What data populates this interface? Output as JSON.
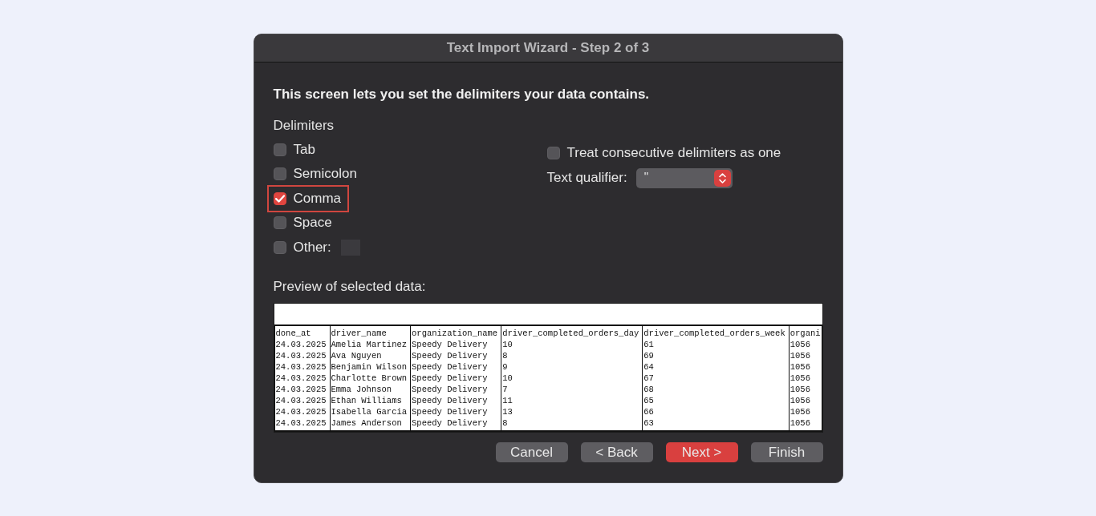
{
  "window": {
    "title": "Text Import Wizard - Step 2 of 3"
  },
  "instruction": "This screen lets you set the delimiters your data contains.",
  "delimiters": {
    "heading": "Delimiters",
    "options": [
      {
        "label": "Tab",
        "kind": "plain",
        "checked": false,
        "highlighted": false
      },
      {
        "label": "Semicolon",
        "kind": "plain",
        "checked": false,
        "highlighted": false
      },
      {
        "label": "Comma",
        "kind": "plain",
        "checked": true,
        "highlighted": true
      },
      {
        "label": "Space",
        "kind": "plain",
        "checked": false,
        "highlighted": false
      },
      {
        "label": "Other:",
        "kind": "field",
        "checked": false,
        "highlighted": false
      }
    ]
  },
  "consecutive": {
    "label": "Treat consecutive delimiters as one",
    "checked": false
  },
  "text_qualifier": {
    "label": "Text qualifier:",
    "value": "\""
  },
  "preview": {
    "label": "Preview of selected data:",
    "columns": [
      "done_at",
      "driver_name",
      "organization_name",
      "driver_completed_orders_day",
      "driver_completed_orders_week",
      "organi"
    ],
    "rows": [
      [
        "24.03.2025",
        "Amelia Martinez",
        "Speedy Delivery",
        "10",
        "61",
        "1056"
      ],
      [
        "24.03.2025",
        "Ava Nguyen",
        "Speedy Delivery",
        "8",
        "69",
        "1056"
      ],
      [
        "24.03.2025",
        "Benjamin Wilson",
        "Speedy Delivery",
        "9",
        "64",
        "1056"
      ],
      [
        "24.03.2025",
        "Charlotte Brown",
        "Speedy Delivery",
        "10",
        "67",
        "1056"
      ],
      [
        "24.03.2025",
        "Emma Johnson",
        "Speedy Delivery",
        "7",
        "68",
        "1056"
      ],
      [
        "24.03.2025",
        "Ethan Williams",
        "Speedy Delivery",
        "11",
        "65",
        "1056"
      ],
      [
        "24.03.2025",
        "Isabella Garcia",
        "Speedy Delivery",
        "13",
        "66",
        "1056"
      ],
      [
        "24.03.2025",
        "James Anderson",
        "Speedy Delivery",
        "8",
        "63",
        "1056"
      ]
    ]
  },
  "buttons": [
    {
      "label": "Cancel",
      "primary": false
    },
    {
      "label": "< Back",
      "primary": false
    },
    {
      "label": "Next >",
      "primary": true
    },
    {
      "label": "Finish",
      "primary": false
    }
  ]
}
